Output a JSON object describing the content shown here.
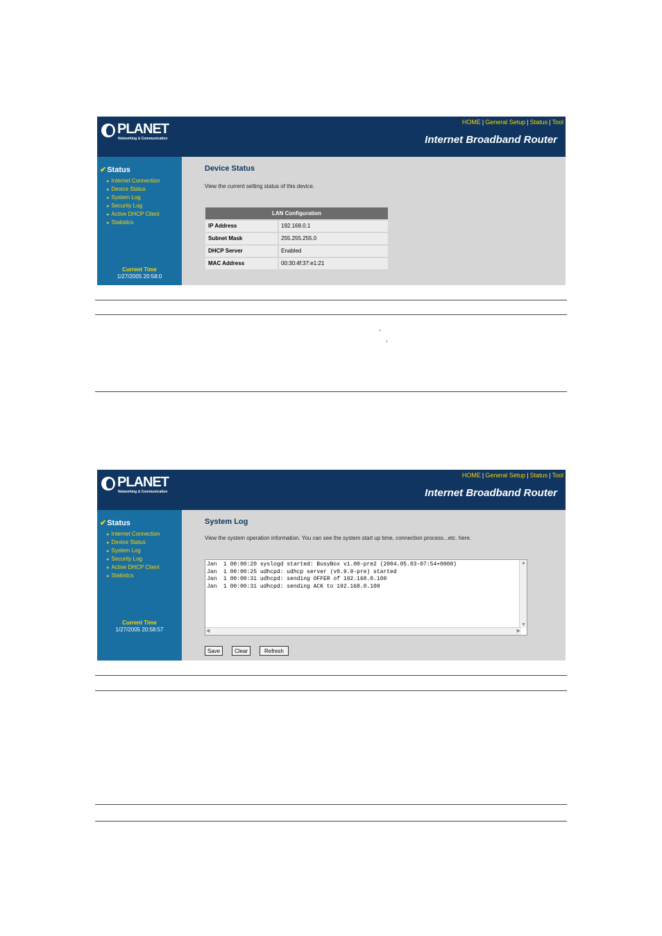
{
  "header": {
    "brand": "PLANET",
    "brand_sub": "Networking & Communication",
    "nav": [
      "HOME",
      "General Setup",
      "Status",
      "Tool"
    ],
    "router_title": "Internet Broadband Router"
  },
  "sidebar": {
    "title": "Status",
    "items": [
      "Internet Connection",
      "Device Status",
      "System Log",
      "Security Log",
      "Active DHCP Client",
      "Statistics"
    ],
    "current_time_label": "Current Time"
  },
  "screen1": {
    "heading": "Device Status",
    "description": "View the current setting status of this device.",
    "current_time": "1/27/2005 20:58:0",
    "lan": {
      "title": "LAN Configuration",
      "rows": [
        {
          "label": "IP Address",
          "value": "192.168.0.1"
        },
        {
          "label": "Subnet Mask",
          "value": "255.255.255.0"
        },
        {
          "label": "DHCP Server",
          "value": "Enabled"
        },
        {
          "label": "MAC Address",
          "value": "00:30:4f:37:e1:21"
        }
      ]
    }
  },
  "screen2": {
    "heading": "System Log",
    "description": "View the system operation information. You can see the system start up time, connection process...etc. here.",
    "current_time": "1/27/2005 20:58:57",
    "log": [
      "Jan  1 00:00:20 syslogd started: BusyBox v1.00-pre2 (2004.05.03-07:54+0000)",
      "Jan  1 00:00:25 udhcpd: udhcp server (v0.9.9-pre) started",
      "Jan  1 00:00:31 udhcpd: sending OFFER of 192.168.0.100",
      "Jan  1 00:00:31 udhcpd: sending ACK to 192.168.0.100"
    ],
    "buttons": {
      "save": "Save",
      "clear": "Clear",
      "refresh": "Refresh"
    }
  },
  "stray_marks": [
    ",",
    ","
  ],
  "colors": {
    "header_bg": "#0f3560",
    "sidebar_bg": "#1a6fa2",
    "accent_yellow": "#ffd500",
    "content_bg": "#d6d6d6"
  }
}
